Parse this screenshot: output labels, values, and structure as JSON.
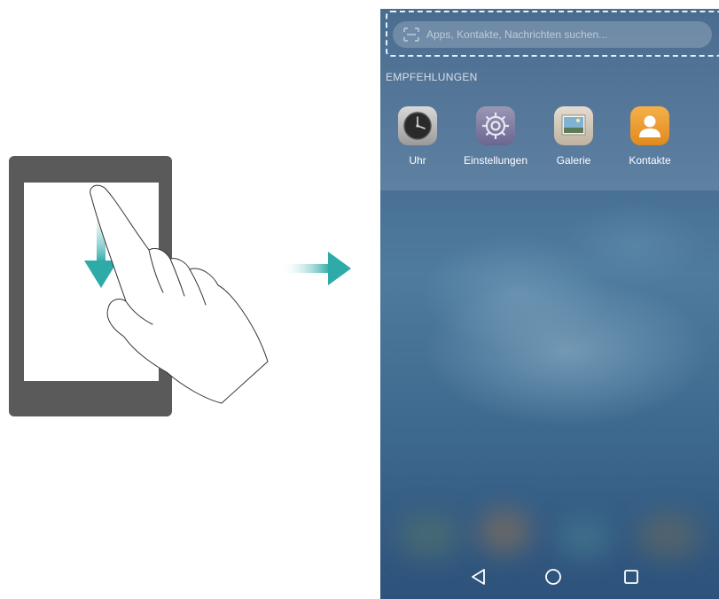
{
  "search": {
    "placeholder": "Apps, Kontakte, Nachrichten suchen..."
  },
  "section": {
    "title": "EMPFEHLUNGEN"
  },
  "apps": [
    {
      "label": "Uhr",
      "icon": "clock-icon"
    },
    {
      "label": "Einstellungen",
      "icon": "gear-icon"
    },
    {
      "label": "Galerie",
      "icon": "gallery-icon"
    },
    {
      "label": "Kontakte",
      "icon": "contacts-icon"
    }
  ],
  "nav": {
    "icons": [
      "back-icon",
      "home-icon",
      "recents-icon"
    ]
  },
  "colors": {
    "arrow_teal": "#2eaaa8",
    "phone_bg": "#466c92",
    "highlight": "#dff3ff"
  }
}
